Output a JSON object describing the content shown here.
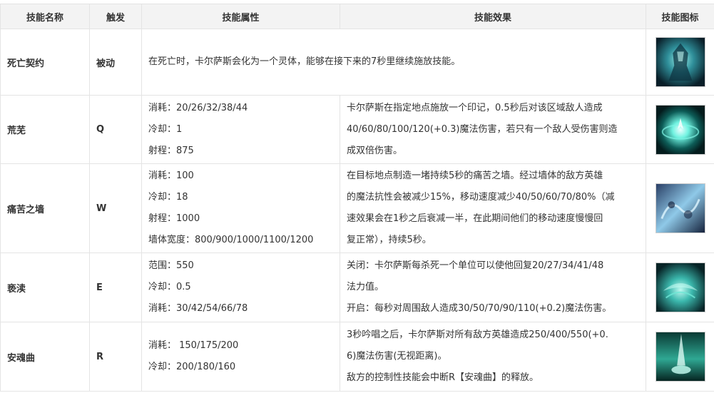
{
  "headers": {
    "name": "技能名称",
    "trigger": "触发",
    "attributes": "技能属性",
    "effect": "技能效果",
    "icon": "技能图标"
  },
  "rows": [
    {
      "name": "死亡契约",
      "trigger": "被动",
      "effect_full": "在死亡时，卡尔萨斯会化为一个灵体，能够在接下来的7秒里继续施放技能。",
      "icon": "passive-death-defied-icon",
      "icon_colors": [
        "#0e2a33",
        "#4fd3c8"
      ]
    },
    {
      "name": "荒芜",
      "trigger": "Q",
      "attributes": [
        "消耗：20/26/32/38/44",
        "冷却：1",
        "射程：875"
      ],
      "effect": [
        "卡尔萨斯在指定地点施放一个印记，0.5秒后对该区域敌人造成",
        "40/60/80/100/120(+0.3)魔法伤害，若只有一个敌人受伤害则造",
        "成双倍伤害。"
      ],
      "icon": "lay-waste-icon",
      "icon_colors": [
        "#062a2a",
        "#7ff5e6"
      ]
    },
    {
      "name": "痛苦之墙",
      "trigger": "W",
      "attributes": [
        "消耗：100",
        "冷却：18",
        "射程：1000",
        "墙体宽度：800/900/1000/1100/1200"
      ],
      "effect": [
        "在目标地点制造一堵持续5秒的痛苦之墙。经过墙体的敌方英雄",
        "的魔法抗性会被减少15%，移动速度减少40/50/60/70/80%（减",
        "速效果会在1秒之后衰减一半，在此期间他们的移动速度慢慢回",
        "复正常），持续5秒。"
      ],
      "icon": "wall-of-pain-icon",
      "icon_colors": [
        "#1b2a45",
        "#9fd8f0"
      ]
    },
    {
      "name": "亵渎",
      "trigger": "E",
      "attributes": [
        "范围：550",
        "冷却：0.5",
        "消耗：30/42/54/66/78"
      ],
      "effect": [
        "关闭：卡尔萨斯每杀死一个单位可以使他回复20/27/34/41/48",
        "法力值。",
        "开启：每秒对周围敌人造成30/50/70/90/110(+0.2)魔法伤害。"
      ],
      "icon": "defile-icon",
      "icon_colors": [
        "#0b2d30",
        "#6fe7d6"
      ]
    },
    {
      "name": "安魂曲",
      "trigger": "R",
      "attributes": [
        "消耗： 150/175/200",
        "冷却：200/180/160"
      ],
      "effect": [
        "3秒吟唱之后，卡尔萨斯对所有敌方英雄造成250/400/550(+0.",
        "6)魔法伤害(无视距离)。",
        "敌方的控制性技能会中断R【安魂曲】的释放。"
      ],
      "icon": "requiem-icon",
      "icon_colors": [
        "#07302c",
        "#c8fff4"
      ]
    }
  ]
}
